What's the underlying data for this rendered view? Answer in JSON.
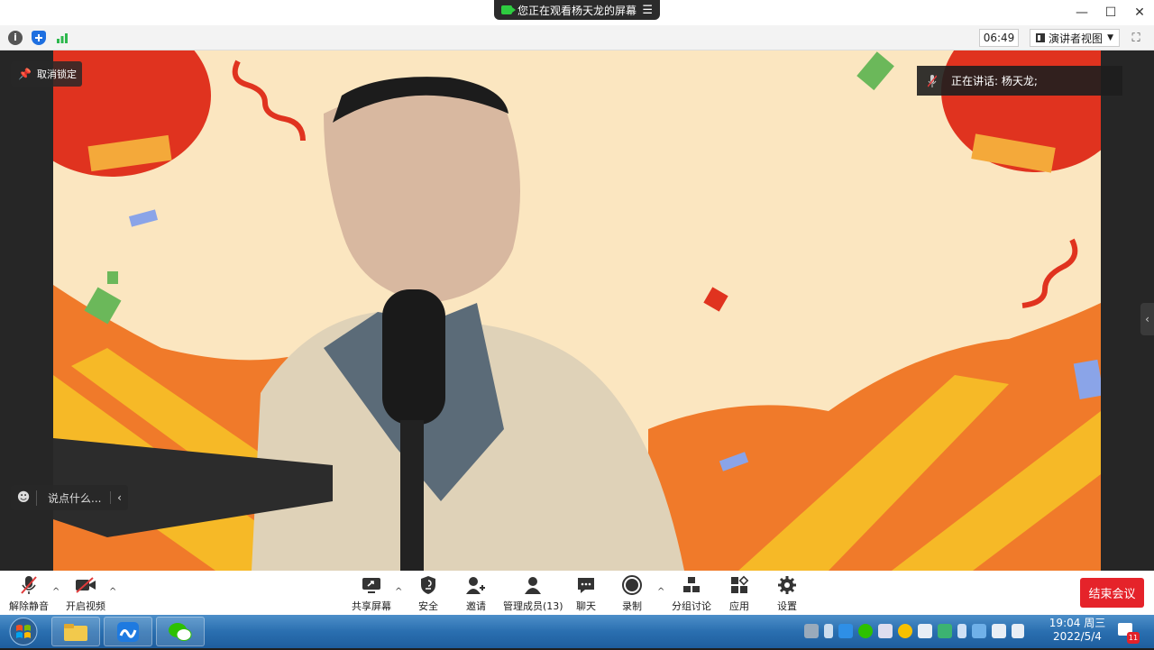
{
  "titlebar": {
    "share_notice": "您正在观看杨天龙的屏幕",
    "menu_icon": "menu-icon",
    "window_controls": [
      "minimize-icon",
      "maximize-icon",
      "close-icon"
    ]
  },
  "infobar": {
    "icons": [
      "info-icon",
      "security-shield-icon",
      "signal-icon"
    ],
    "timer": "06:49",
    "view_mode_label": "演讲者视图",
    "fullscreen_icon": "fullscreen-icon"
  },
  "stage": {
    "unpin_label": "取消锁定",
    "speaking_label": "正在讲话: 杨天龙;",
    "chat_placeholder": "说点什么...",
    "background_colors": {
      "cream": "#fbe6c0",
      "orange": "#f07a2a",
      "yellow": "#f6b927",
      "red": "#e0331f"
    }
  },
  "toolbar": {
    "unmute": "解除静音",
    "start_video": "开启视频",
    "share_screen": "共享屏幕",
    "security": "安全",
    "invite": "邀请",
    "manage_members": "管理成员(13)",
    "chat": "聊天",
    "record": "录制",
    "breakout": "分组讨论",
    "apps": "应用",
    "settings": "设置",
    "end_meeting": "结束会议"
  },
  "taskbar": {
    "time": "19:04 周三",
    "date": "2022/5/4",
    "notification_count": "11",
    "apps": [
      "file-explorer-icon",
      "tencent-meeting-icon",
      "wechat-icon"
    ]
  }
}
